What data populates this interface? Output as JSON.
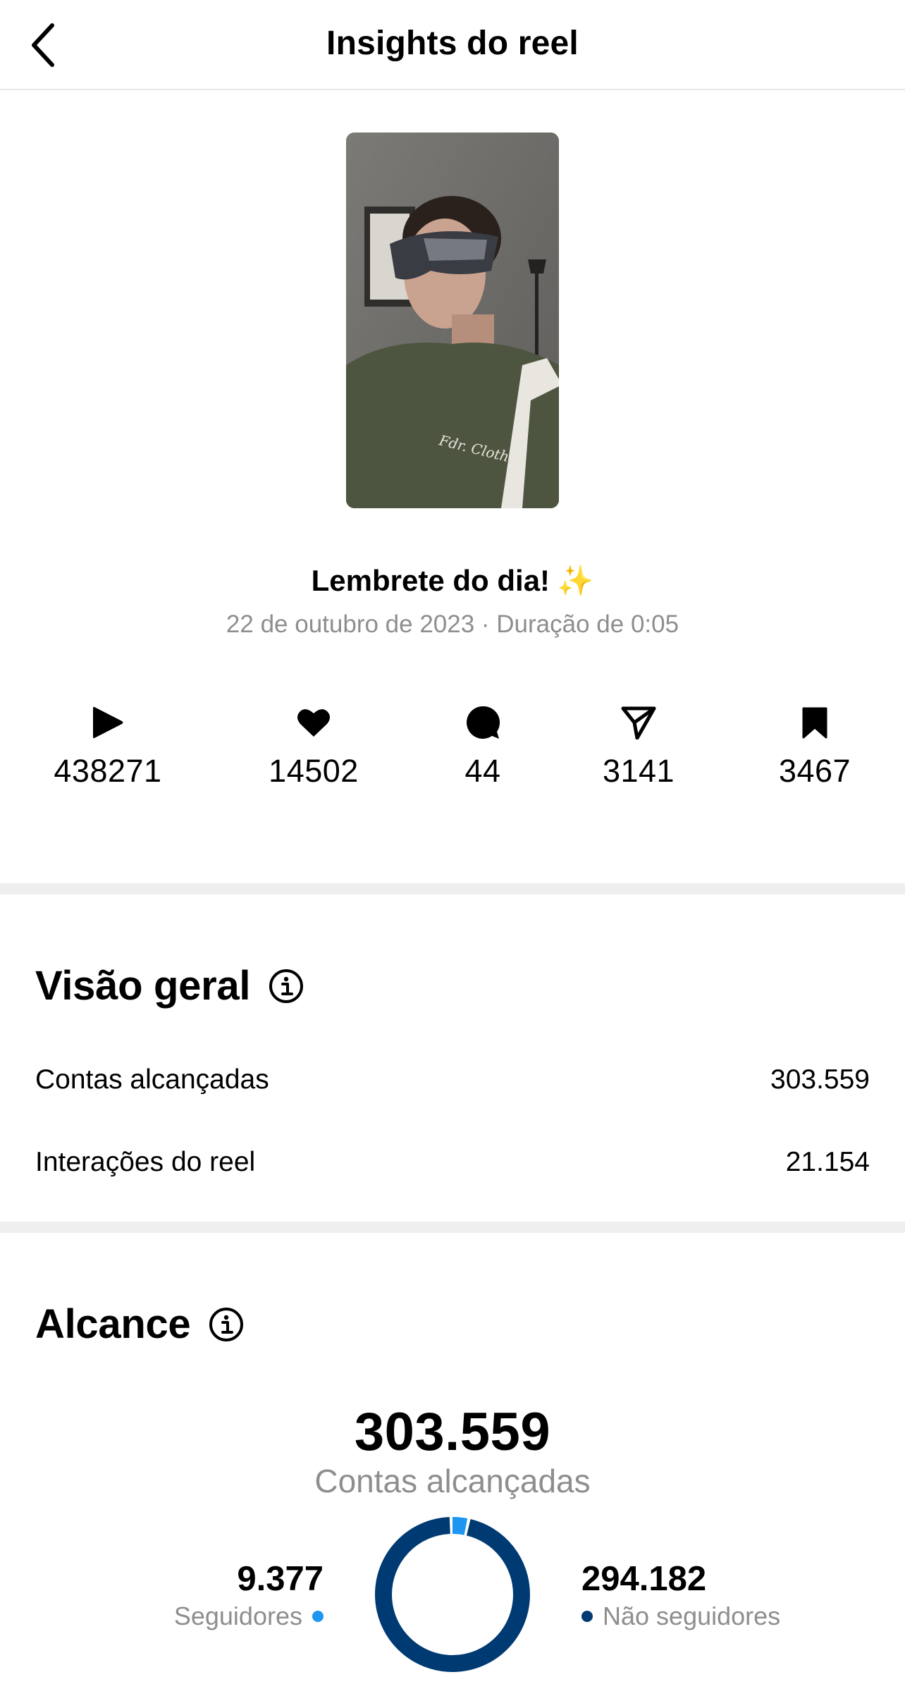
{
  "header": {
    "title": "Insights do reel"
  },
  "reel": {
    "caption": "Lembrete do dia!",
    "caption_emoji": "✨",
    "meta": "22 de outubro de 2023 · Duração de 0:05",
    "thumbnail_text": "Fdr. Clothi"
  },
  "stats": [
    {
      "icon": "play-icon",
      "value": "438271"
    },
    {
      "icon": "heart-icon",
      "value": "14502"
    },
    {
      "icon": "comment-icon",
      "value": "44"
    },
    {
      "icon": "share-icon",
      "value": "3141"
    },
    {
      "icon": "bookmark-icon",
      "value": "3467"
    }
  ],
  "overview": {
    "title": "Visão geral",
    "rows": [
      {
        "label": "Contas alcançadas",
        "value": "303.559"
      },
      {
        "label": "Interações do reel",
        "value": "21.154"
      }
    ]
  },
  "reach": {
    "title": "Alcance",
    "total": "303.559",
    "total_label": "Contas alcançadas",
    "followers": {
      "value": "9.377",
      "label": "Seguidores",
      "count": 9377,
      "color": "#1c96f0"
    },
    "non_followers": {
      "value": "294.182",
      "label": "Não seguidores",
      "count": 294182,
      "color": "#003a73"
    }
  }
}
